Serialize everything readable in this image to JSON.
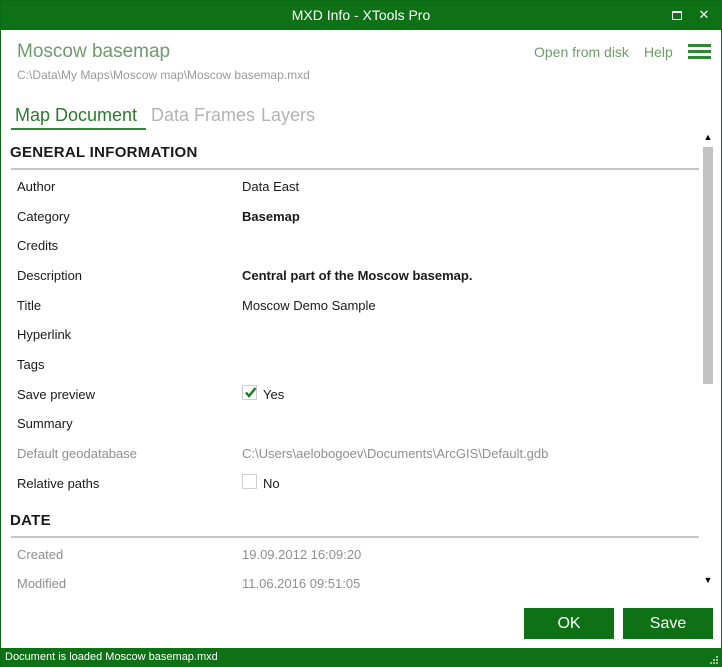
{
  "window": {
    "title": "MXD Info - XTools Pro"
  },
  "header": {
    "doc_title": "Moscow basemap",
    "doc_path": "C:\\Data\\My Maps\\Moscow map\\Moscow basemap.mxd",
    "open_link": "Open from disk",
    "help_link": "Help"
  },
  "tabs": [
    {
      "label": "Map Document",
      "active": true
    },
    {
      "label": "Data Frames",
      "active": false
    },
    {
      "label": "Layers",
      "active": false
    }
  ],
  "general": {
    "title": "GENERAL INFORMATION",
    "rows": [
      {
        "label": "Author",
        "value": "Data East"
      },
      {
        "label": "Category",
        "value": "Basemap"
      },
      {
        "label": "Credits",
        "value": ""
      },
      {
        "label": "Description",
        "value": "Central part of the Moscow basemap."
      },
      {
        "label": "Title",
        "value": "Moscow Demo Sample"
      },
      {
        "label": "Hyperlink",
        "value": ""
      },
      {
        "label": "Tags",
        "value": ""
      },
      {
        "label": "Save preview",
        "value": "Yes",
        "checked": true
      },
      {
        "label": "Summary",
        "value": ""
      },
      {
        "label": "Default geodatabase",
        "value": "C:\\Users\\aelobogoev\\Documents\\ArcGIS\\Default.gdb"
      },
      {
        "label": "Relative paths",
        "value": "No",
        "checked": false
      }
    ]
  },
  "date": {
    "title": "DATE",
    "rows": [
      {
        "label": "Created",
        "value": "19.09.2012 16:09:20"
      },
      {
        "label": "Modified",
        "value": "11.06.2016 09:51:05"
      }
    ]
  },
  "buttons": {
    "ok": "OK",
    "save": "Save"
  },
  "status": {
    "text": "Document is loaded Moscow basemap.mxd"
  },
  "colors": {
    "accent": "#0f7116",
    "link": "#6e9a6c",
    "muted": "#8f8f8f"
  }
}
